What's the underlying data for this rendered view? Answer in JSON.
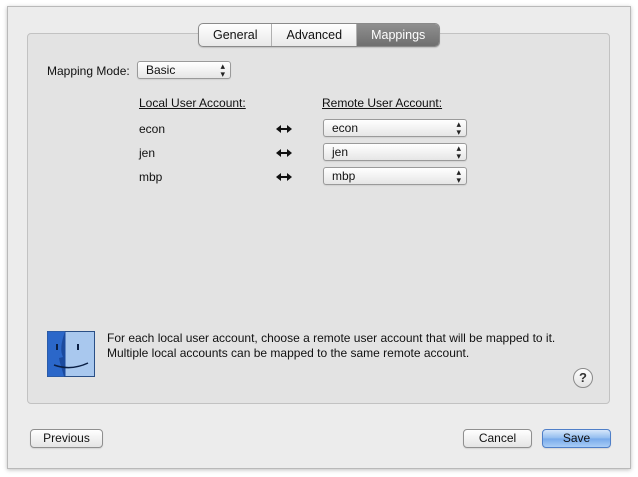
{
  "tabs": [
    {
      "label": "General"
    },
    {
      "label": "Advanced"
    },
    {
      "label": "Mappings"
    }
  ],
  "mapping_mode": {
    "label": "Mapping Mode:",
    "value": "Basic"
  },
  "columns": {
    "local": "Local User Account:",
    "remote": "Remote User Account:"
  },
  "mappings": [
    {
      "local": "econ",
      "remote": "econ"
    },
    {
      "local": "jen",
      "remote": "jen"
    },
    {
      "local": "mbp",
      "remote": "mbp"
    }
  ],
  "info_text": "For each local user account, choose a remote user account that will be mapped to it. Multiple local accounts can be mapped to the same remote account.",
  "help_label": "?",
  "buttons": {
    "previous": "Previous",
    "cancel": "Cancel",
    "save": "Save"
  },
  "icons": {
    "swap": "double-arrow-icon",
    "finder": "finder-face-icon"
  },
  "colors": {
    "active_tab": "#7f7f7f",
    "default_button": "#8fbbef"
  }
}
